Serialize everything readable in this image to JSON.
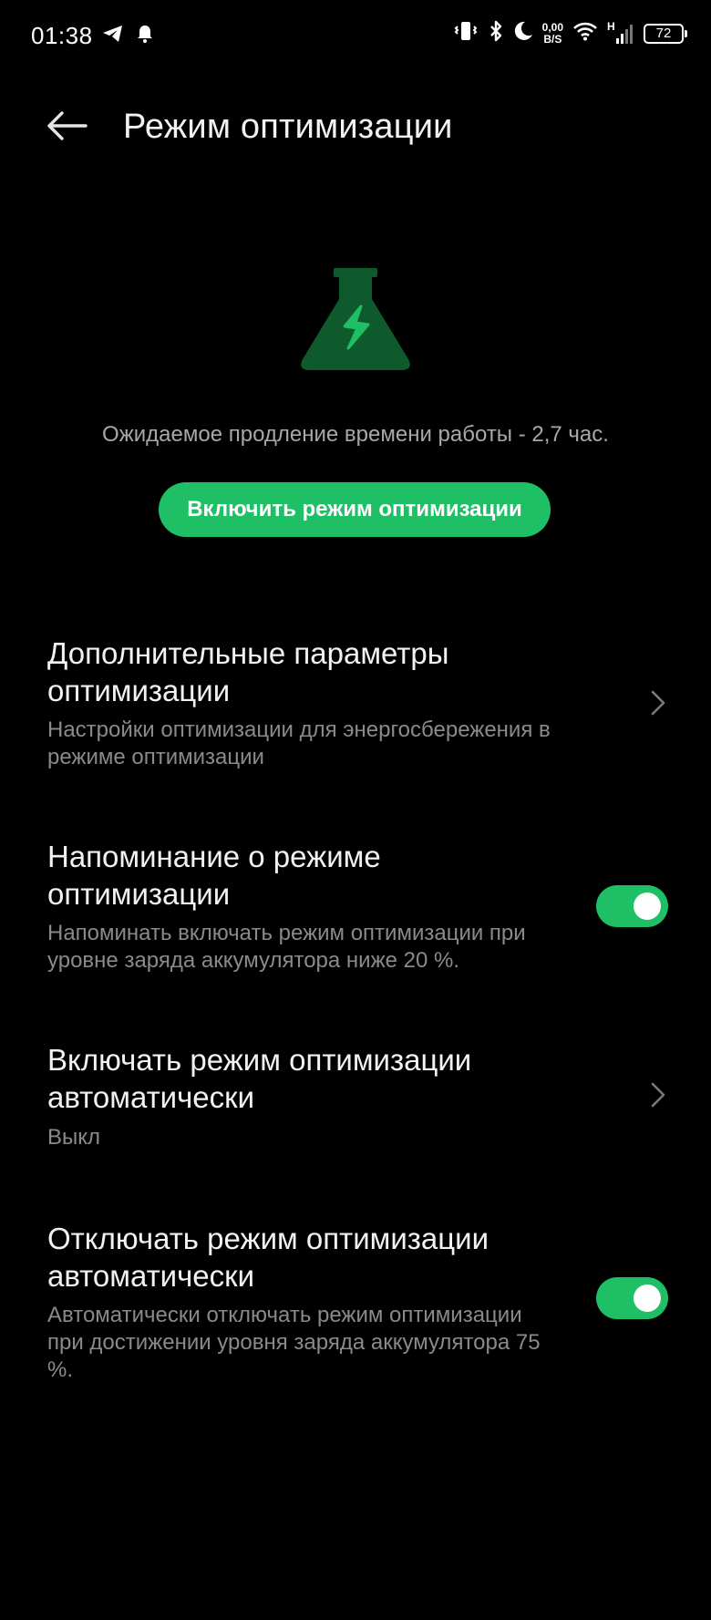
{
  "status_bar": {
    "time": "01:38",
    "speed_value": "0,00",
    "speed_unit": "B/S",
    "network_type": "H",
    "battery_level": "72",
    "icons": [
      "telegram-icon",
      "bell-icon",
      "vibrate-icon",
      "bluetooth-icon",
      "moon-icon",
      "wifi-icon",
      "signal-icon",
      "battery-icon"
    ]
  },
  "header": {
    "title": "Режим оптимизации",
    "back_icon": "arrow-left-icon"
  },
  "hero": {
    "icon": "flask-lightning-icon",
    "estimate": "Ожидаемое продление времени работы - 2,7 час.",
    "button_label": "Включить режим оптимизации"
  },
  "settings": [
    {
      "title": "Дополнительные параметры оптимизации",
      "subtitle": "Настройки оптимизации для энергосбережения в режиме оптимизации",
      "control": "chevron"
    },
    {
      "title": "Напоминание о режиме оптимизации",
      "subtitle": "Напоминать включать режим оптимизации при уровне заряда аккумулятора ниже 20 %.",
      "control": "toggle",
      "toggle_on": true
    },
    {
      "title": "Включать режим оптимизации автоматически",
      "subtitle": "Выкл",
      "control": "chevron"
    },
    {
      "title": "Отключать режим оптимизации автоматически",
      "subtitle": "Автоматически отключать режим оптимизации при достижении уровня заряда аккумулятора 75 %.",
      "control": "toggle",
      "toggle_on": true
    }
  ],
  "colors": {
    "accent": "#1fbf66",
    "background": "#000000",
    "primary_text": "#f2f2f2",
    "secondary_text": "#8a8a8a",
    "icon_dark_green": "#0e5a2d"
  }
}
